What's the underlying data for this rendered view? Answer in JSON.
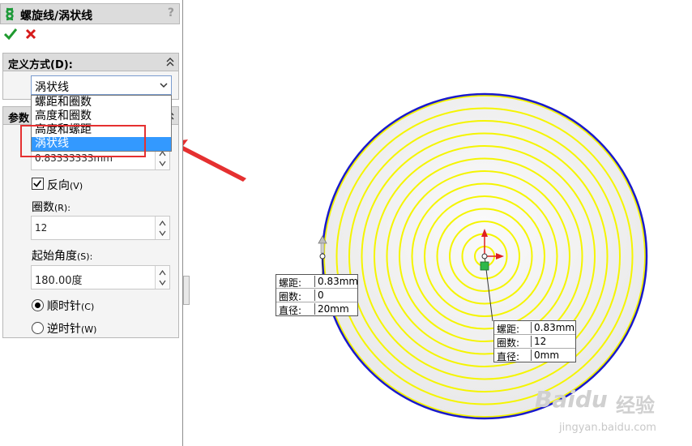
{
  "panel": {
    "title": "螺旋线/涡状线",
    "help": "?"
  },
  "definition": {
    "heading": "定义方式(D):",
    "selected": "涡状线",
    "options": [
      "螺距和圈数",
      "高度和圈数",
      "高度和螺距",
      "涡状线"
    ],
    "selected_index": 3
  },
  "parameters": {
    "heading": "参数",
    "pitch_value": "0.83333333mm",
    "reverse_label": "反向",
    "reverse_key": "(V)",
    "reverse_checked": true,
    "turns_label": "圈数",
    "turns_key": "(R):",
    "turns_value": "12",
    "start_angle_label": "起始角度",
    "start_angle_key": "(S):",
    "start_angle_value": "180.00度",
    "clockwise_label": "顺时针",
    "clockwise_key": "(C)",
    "counterclockwise_label": "逆时针",
    "counterclockwise_key": "(W)",
    "direction_selected": "clockwise"
  },
  "callouts": {
    "start": {
      "pitch_label": "螺距:",
      "pitch_value": "0.83mm",
      "turns_label": "圈数:",
      "turns_value": "0",
      "diameter_label": "直径:",
      "diameter_value": "20mm"
    },
    "end": {
      "pitch_label": "螺距:",
      "pitch_value": "0.83mm",
      "turns_label": "圈数:",
      "turns_value": "12",
      "diameter_label": "直径:",
      "diameter_value": "0mm"
    }
  },
  "watermark": {
    "logo": "Baidu",
    "cn": "经验",
    "url": "jingyan.baidu.com"
  },
  "colors": {
    "spiral": "#f5f500",
    "outer_circle": "#1a1acc",
    "annotation_red": "#e53030",
    "selection_blue": "#3399ff"
  }
}
